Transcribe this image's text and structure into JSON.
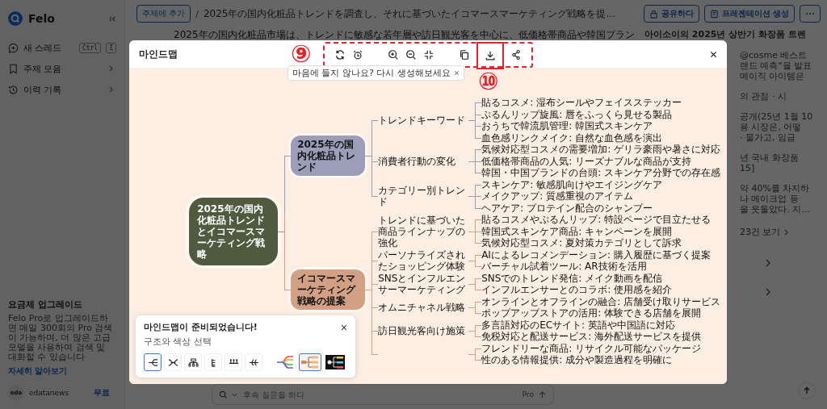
{
  "sidebar": {
    "brand": "Felo",
    "items": [
      {
        "label": "새 스레드",
        "kind": "shortcut",
        "keys": [
          "Ctrl",
          "I"
        ]
      },
      {
        "label": "주제 모음",
        "kind": "submenu"
      },
      {
        "label": "이력 기록",
        "kind": "submenu"
      }
    ],
    "upgrade": {
      "title": "요금제 업그레이드",
      "text": "Felo Pro로 업그레이드하면 매일 300회의 Pro 검색이 가능하며, 더 많은 고급 모델을 사용하여 검색 및 대화할 수 있습니다",
      "link": "자세히 알아보기"
    },
    "user": {
      "avatar": "eda",
      "name": "edatanews",
      "plan": "무료"
    }
  },
  "topbar": {
    "add_button": "주제에 추가",
    "separator": "/",
    "breadcrumb": "2025年の国内化粧品トレンドを調査し、それに基づいたイコマースマーケティング戦略を提...",
    "buttons": [
      {
        "label": "공유하다",
        "kind": "share"
      },
      {
        "label": "프레젠테이션 생성",
        "kind": "slides"
      }
    ]
  },
  "article": {
    "text": "2025年の国内化粧品市場は、トレンドに敏感な若年層や訪日観光客を中心に、低価格帯商品や韓国ブラン"
  },
  "sources": {
    "header": "아이소이의 2025년 상반기 화장품 트렌",
    "groups": [
      {
        "lines": [
          "@cosme 베스트",
          "랜드 예측\"을 발표",
          "메이직 아이템은"
        ]
      },
      {
        "lines": [
          "의 관점 · 시"
        ]
      },
      {
        "lines": [
          "공개(25년 1월 10",
          "용 시장은, 어떻",
          "· 물가고, 임금"
        ]
      },
      {
        "lines": [
          "년 국내 화장품",
          "15]"
        ]
      },
      {
        "lines": [
          "약 40%를 차지하",
          "나 메이크업 등",
          "을 웃돌았다. 지..."
        ]
      }
    ],
    "more_link": "23건 보기"
  },
  "follow_up": {
    "placeholder": "후속 질문을 하다",
    "mode": "Pro"
  },
  "mindmap_dialog": {
    "title": "마인드맵",
    "tooltip": "마음에 들지 않나요? 다시 생성해보세요",
    "mindmap": {
      "label": "2025年の国内化粧品トレンドとイコマースマーケティング戦略",
      "children": [
        {
          "label": "2025年の国内化粧品トレンド",
          "color": "#9b9db9",
          "children": [
            {
              "label": "トレンドキーワード",
              "children": [
                "貼るコスメ: 湿布シールやフェイスステッカー",
                "ぷるんリップ旋風: 唇をふっくら見せる製品",
                "おうちで韓流肌管理: 韓国式スキンケア",
                "血色感リンクメイク: 自然な血色感を演出"
              ]
            },
            {
              "label": "消費者行動の変化",
              "children": [
                "気候対応型コスメの需要増加: ゲリラ豪雨や暑さに対応",
                "低価格帯商品の人気: リーズナブルな商品が支持",
                "韓国・中国ブランドの台頭: スキンケア分野での存在感"
              ]
            },
            {
              "label": "カテゴリー別トレンド",
              "children": [
                "スキンケア: 敏感肌向けやエイジングケア",
                "メイクアップ: 質感重視のアイテム",
                "ヘアケア: プロテイン配合のシャンプー"
              ]
            }
          ]
        },
        {
          "label": "イコマースマーケティング戦略の提案",
          "color": "#d2a084",
          "children": [
            {
              "label": "トレンドに基づいた商品ラインナップの強化",
              "children": [
                "貼るコスメやぷるんリップ: 特設ページで目立たせる",
                "韓国式スキンケア商品: キャンペーンを展開",
                "気候対応型コスメ: 夏対策カテゴリとして訴求"
              ]
            },
            {
              "label": "パーソナライズされたショッピング体験",
              "children": [
                "AIによるレコメンデーション: 購入履歴に基づく提案",
                "バーチャル試着ツール: AR技術を活用"
              ]
            },
            {
              "label": "SNSとインフルエンサーマーケティング",
              "children": [
                "SNSでのトレンド発信: メイク動画を配信",
                "インフルエンサーとのコラボ: 使用感を紹介"
              ]
            },
            {
              "label": "オムニチャネル戦略",
              "children": [
                "オンラインとオフラインの融合: 店舗受け取りサービス",
                "ポップアップストアの活用: 体験できる店舗を展開"
              ]
            },
            {
              "label": "訪日観光客向け施策",
              "children": [
                "多言語対応のECサイト: 英語や中国語に対応",
                "免税対応と配送サービス: 海外配送サービスを提供"
              ]
            },
            {
              "children": [
                "フレンドリーな商品: リサイクル可能なパッケージ",
                "性のある情報提供: 成分や製造過程を明確に"
              ]
            }
          ]
        }
      ]
    },
    "panel": {
      "title": "마인드맵이 준비되었습니다!",
      "subtitle": "구조와 색상 선택",
      "layouts": [
        {
          "kind": "right",
          "selected": true
        },
        {
          "kind": "both",
          "selected": false
        },
        {
          "kind": "org",
          "selected": false
        },
        {
          "kind": "list",
          "selected": false
        },
        {
          "kind": "timeline",
          "selected": false
        },
        {
          "kind": "fishbone",
          "selected": false
        }
      ],
      "themes": [
        {
          "kind": "rainbow",
          "selected": false
        },
        {
          "kind": "warm",
          "selected": true
        },
        {
          "kind": "dark",
          "selected": false
        }
      ]
    }
  },
  "annotations": [
    "⑨",
    "⑩"
  ]
}
